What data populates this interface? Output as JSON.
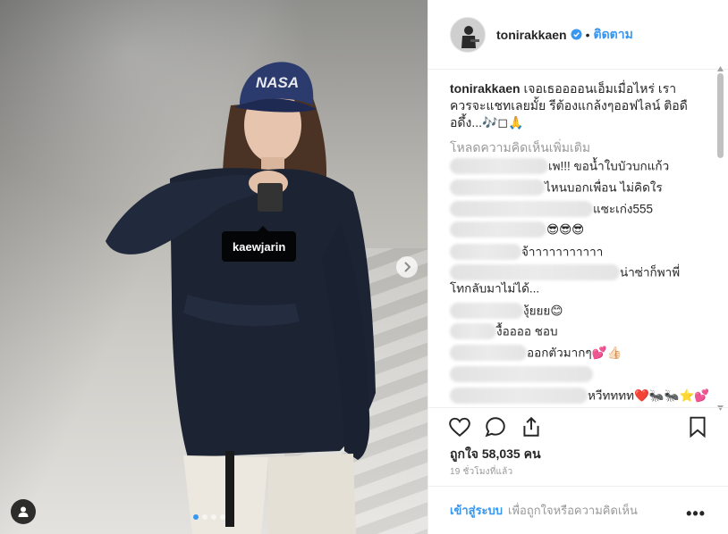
{
  "photo": {
    "tag_label": "kaewjarin",
    "cap_text": "NASA",
    "carousel_dots": 4,
    "active_dot": 1
  },
  "header": {
    "username": "tonirakkaen",
    "separator": "•",
    "follow_label": "ติดตาม"
  },
  "caption": {
    "username": "tonirakkaen",
    "text": "เจอเธออออนเอ็มเมื่อไหร่ เราควรจะแชทเลยมั้ย รีต้องแกล้งๆออฟไลน์ ติอดือดึ้ง...🎶◻🙏"
  },
  "load_more_label": "โหลดความคิดเห็นเพิ่มเติม",
  "comments": [
    {
      "text": "เพ!!! ขอน้ำใบบัวบกแก้ว"
    },
    {
      "text": "ไหนบอกเพื่อน ไม่คิดใร"
    },
    {
      "text": "แซะเก่ง555"
    },
    {
      "text": "😎😎😎"
    },
    {
      "text": "จ้าาาาาาาาาาา"
    },
    {
      "text": "น่าซ่าก็พาพี่โทกลับมาไม่ได้..."
    },
    {
      "text": "งุ้ยยย😊"
    },
    {
      "text": "งื้ออออ ชอบ"
    },
    {
      "text": "ออกตัวมากๆ💕👍🏻"
    },
    {
      "text": ""
    },
    {
      "text": "หวีทททท❤️🐜🐜⭐️💕"
    }
  ],
  "likes": {
    "label": "ถูกใจ",
    "count": "58,035",
    "unit": "คน"
  },
  "timestamp": "19 ชั่วโมงที่แล้ว",
  "footer": {
    "login_label": "เข้าสู่ระบบ",
    "rest_text": "เพื่อถูกใจหรือความคิดเห็น",
    "more_label": "•••"
  },
  "colors": {
    "accent": "#3897f0",
    "text": "#262626",
    "muted": "#999999",
    "divider": "#efefef"
  }
}
